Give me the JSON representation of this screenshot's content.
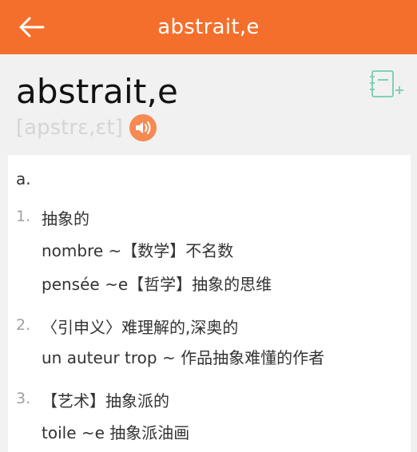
{
  "header": {
    "title": "abstrait,e"
  },
  "entry": {
    "headword": "abstrait,e",
    "phonetic": "[apstrɛ,ɛt]",
    "pos": "a."
  },
  "senses": [
    {
      "num": "1.",
      "lines": [
        "抽象的",
        "nombre ~【数学】不名数",
        "pensée ~e【哲学】抽象的思维"
      ]
    },
    {
      "num": "2.",
      "lines": [
        "〈引申义〉难理解的,深奥的",
        "un auteur trop ~ 作品抽象难懂的作者"
      ]
    },
    {
      "num": "3.",
      "lines": [
        "【艺术】抽象派的",
        "toile ~e 抽象派油画"
      ]
    }
  ],
  "icons": {
    "back": "arrow-left-icon",
    "speaker": "speaker-icon",
    "add_note": "notebook-add-icon"
  },
  "colors": {
    "accent": "#f56f2c",
    "speaker": "#f58a52",
    "add_note": "#7fd0b8"
  }
}
